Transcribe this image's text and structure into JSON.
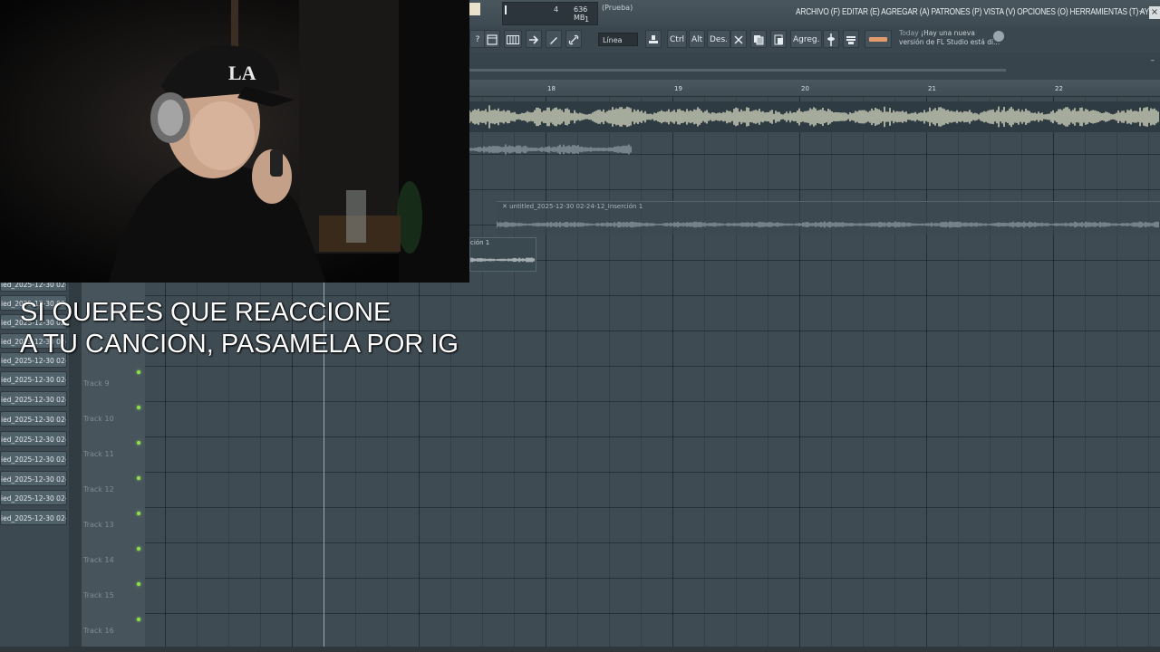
{
  "status": {
    "cpu_value": "4",
    "memory": "636 MB",
    "polyphony": "1",
    "hint": "(Prueba)"
  },
  "menu": {
    "text": "ARCHIVO (F) EDITAR (E) AGREGAR (A) PATRONES (P) VISTA (V) OPCIONES (O) HERRAMIENTAS (T) AYUDA",
    "minimize": "–",
    "close": "×"
  },
  "toolbar": {
    "help": "?",
    "snap": "Línea",
    "ctrl": "Ctrl",
    "alt": "Alt",
    "des": "Des.",
    "agreg": "Agreg."
  },
  "news": {
    "today": "Today",
    "line1": "¡Hay una nueva",
    "line2": "versión de FL Studio está di..."
  },
  "playlist": {
    "corner": "–"
  },
  "ruler": {
    "bars": [
      "18",
      "19",
      "20",
      "21",
      "22"
    ]
  },
  "clips": {
    "insert_title": "untitled_2025-12-30 02-24-12_Inserción 1",
    "small_title": "ción 1"
  },
  "browser": {
    "items": [
      "ied_2025-12-30 02-...",
      "ied_2025-12-30 02-...",
      "ied_2025-12-30 02-...",
      "ied_2025-12-30 02-...",
      "ied_2025-12-30 02-...",
      "ied_2025-12-30 02-...",
      "ied_2025-12-30 02-...",
      "ied_2025-12-30 02-...",
      "ied_2025-12-30 02-...",
      "ied_2025-12-30 02-...",
      "ied_2025-12-30 02-...",
      "ied_2025-12-30 02-...",
      "ied_2025-12-30 02-..."
    ]
  },
  "tracks": [
    "Track 9",
    "Track 10",
    "Track 11",
    "Track 12",
    "Track 13",
    "Track 14",
    "Track 15",
    "Track 16"
  ],
  "caption": {
    "line1": "SI QUERES QUE REACCIONE",
    "line2": "A TU CANCION, PASAMELA POR IG"
  },
  "colors": {
    "accent_led": "#8fe04a",
    "waveform_main": "#d9dcc4",
    "waveform_secondary": "#8e9ba2"
  }
}
